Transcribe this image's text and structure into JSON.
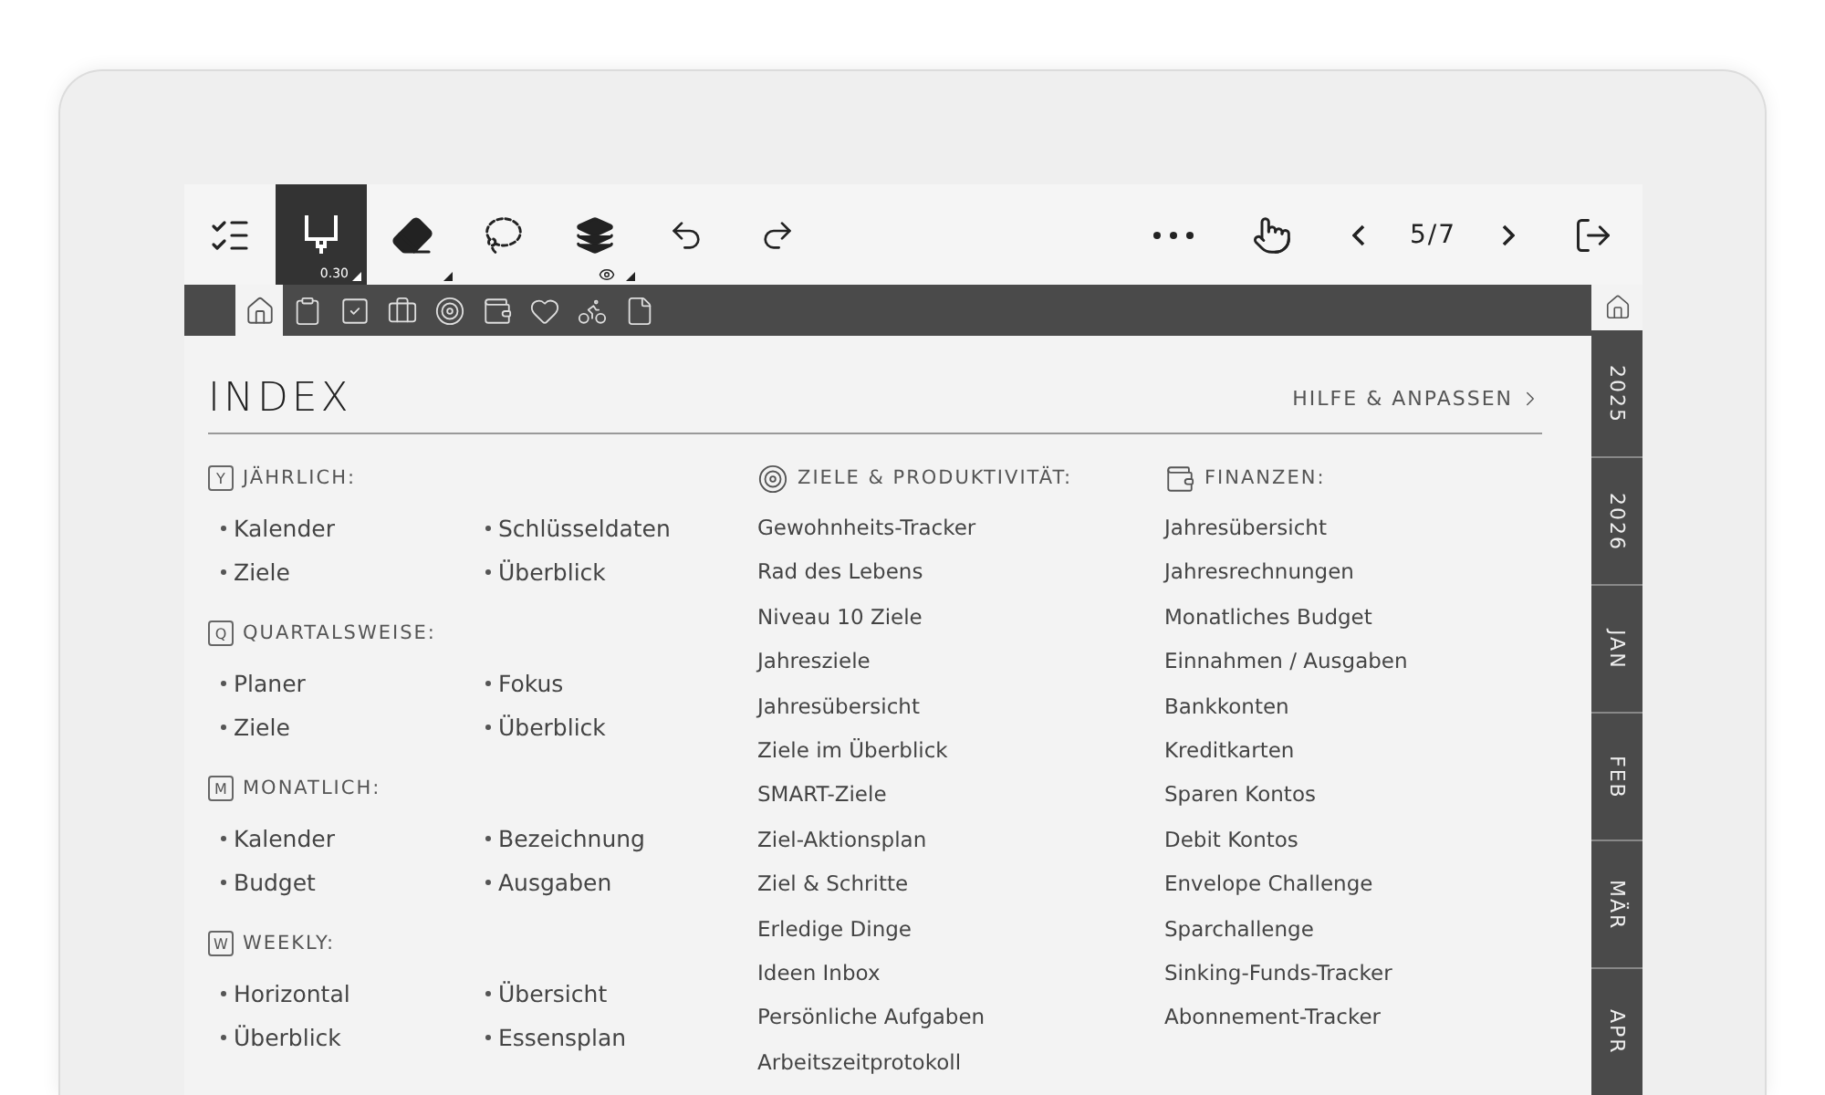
{
  "toolbar": {
    "left_tools": [
      {
        "kind": "menu",
        "selected": false
      },
      {
        "kind": "pen",
        "selected": true,
        "label": "0.30"
      },
      {
        "kind": "eraser",
        "selected": false
      },
      {
        "kind": "lasso",
        "selected": false
      },
      {
        "kind": "layers",
        "selected": false
      },
      {
        "kind": "undo",
        "selected": false
      },
      {
        "kind": "redo",
        "selected": false
      }
    ],
    "right_tools": [
      {
        "kind": "more"
      },
      {
        "kind": "gesture"
      },
      {
        "kind": "prev"
      },
      {
        "kind": "page",
        "label": "5/7"
      },
      {
        "kind": "next"
      },
      {
        "kind": "exit"
      }
    ]
  },
  "tabs": [
    {
      "kind": "home",
      "selected": true
    },
    {
      "kind": "clipboard",
      "selected": false
    },
    {
      "kind": "check",
      "selected": false
    },
    {
      "kind": "briefcase",
      "selected": false
    },
    {
      "kind": "target",
      "selected": false
    },
    {
      "kind": "wallet",
      "selected": false
    },
    {
      "kind": "heart",
      "selected": false
    },
    {
      "kind": "bike",
      "selected": false
    },
    {
      "kind": "page",
      "selected": false
    }
  ],
  "side_tabs": [
    {
      "label": "2025"
    },
    {
      "label": "2026"
    },
    {
      "label": "JAN"
    },
    {
      "label": "FEB"
    },
    {
      "label": "MÄR"
    },
    {
      "label": "APR"
    }
  ],
  "index": {
    "title": "INDEX",
    "help_link": "HILFE & ANPASSEN",
    "periods": [
      {
        "badge": "Y",
        "heading": "JÄHRLICH:",
        "items": [
          "Kalender",
          "Schlüsseldaten",
          "Ziele",
          "Überblick"
        ]
      },
      {
        "badge": "Q",
        "heading": "QUARTALSWEISE:",
        "items": [
          "Planer",
          "Fokus",
          "Ziele",
          "Überblick"
        ]
      },
      {
        "badge": "M",
        "heading": "MONATLICH:",
        "items": [
          "Kalender",
          "Bezeichnung",
          "Budget",
          "Ausgaben"
        ]
      },
      {
        "badge": "W",
        "heading": "WEEKLY:",
        "items": [
          "Horizontal",
          "Übersicht",
          "Überblick",
          "Essensplan"
        ]
      }
    ],
    "lists": [
      {
        "kind": "target",
        "heading": "ZIELE & PRODUKTIVITÄT:",
        "items": [
          "Gewohnheits-Tracker",
          "Rad des Lebens",
          "Niveau 10 Ziele",
          "Jahresziele",
          "Jahresübersicht",
          "Ziele im Überblick",
          "SMART-Ziele",
          "Ziel-Aktionsplan",
          "Ziel & Schritte",
          "Erledige Dinge",
          "Ideen Inbox",
          "Persönliche Aufgaben",
          "Arbeitszeitprotokoll"
        ]
      },
      {
        "kind": "wallet",
        "heading": "FINANZEN:",
        "items": [
          "Jahresübersicht",
          "Jahresrechnungen",
          "Monatliches Budget",
          "Einnahmen / Ausgaben",
          "Bankkonten",
          "Kreditkarten",
          "Sparen Kontos",
          "Debit Kontos",
          "Envelope Challenge",
          "Sparchallenge",
          "Sinking-Funds-Tracker",
          "Abonnement-Tracker"
        ]
      }
    ]
  }
}
